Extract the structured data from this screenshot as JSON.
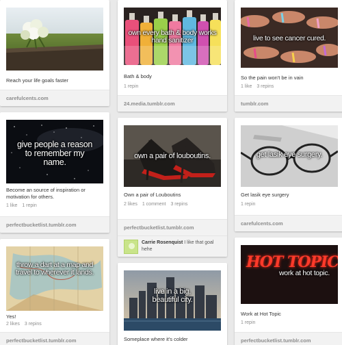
{
  "pins": [
    {
      "overlay": "",
      "description": "Reach your life goals faster",
      "stats": [],
      "source": "carefulcents.com"
    },
    {
      "overlay": "own every bath & body works hand sanitizer",
      "description": "Bath & body",
      "stats": [
        "1 repin"
      ],
      "source": "24.media.tumblr.com"
    },
    {
      "overlay": "live to see cancer cured.",
      "description": "So the pain won't be in vain",
      "stats": [
        "1 like",
        "3 repins"
      ],
      "source": "tumblr.com"
    },
    {
      "overlay": "give people a reason to remember my name.",
      "description": "Become an source of inspiration or motivation for others.",
      "stats": [
        "1 like",
        "1 repin"
      ],
      "source": "perfectbucketlist.tumblr.com"
    },
    {
      "overlay": "own a pair of louboutins.",
      "description": "Own a pair of Louboutins",
      "stats": [
        "2 likes",
        "1 comment",
        "3 repins"
      ],
      "source": "perfectbucketlist.tumblr.com",
      "comment": {
        "author": "Carrie Rosenquist",
        "text": "I like that goal hehe"
      }
    },
    {
      "overlay": "get lasik eye surgery.",
      "description": "Get lasik eye surgery",
      "stats": [
        "1 repin"
      ],
      "source": "carefulcents.com"
    },
    {
      "overlay": "throw a dart at a map and travel to wherever it lands.",
      "description": "Yes!",
      "stats": [
        "2 likes",
        "3 repins"
      ],
      "source": "perfectbucketlist.tumblr.com"
    },
    {
      "overlay": "live in a big, beautiful city.",
      "description": "Someplace where it's colder",
      "stats": [],
      "source": ""
    },
    {
      "overlay": "work at hot topic.",
      "logo_text": "HOT TOPIC",
      "description": "Work at Hot Topic",
      "stats": [
        "1 repin"
      ],
      "source": "perfectbucketlist.tumblr.com"
    }
  ]
}
